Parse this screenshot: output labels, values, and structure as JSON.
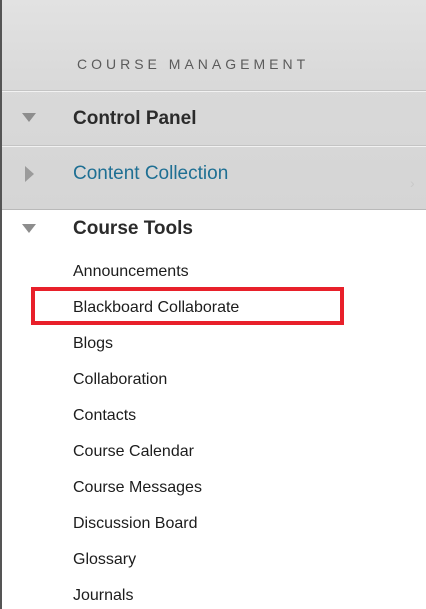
{
  "section_heading": "COURSE MANAGEMENT",
  "control_panel": {
    "label": "Control Panel",
    "expanded": true
  },
  "content_collection": {
    "label": "Content Collection",
    "expanded": false
  },
  "course_tools": {
    "label": "Course Tools",
    "expanded": true,
    "items": [
      "Announcements",
      "Blackboard Collaborate",
      "Blogs",
      "Collaboration",
      "Contacts",
      "Course Calendar",
      "Course Messages",
      "Discussion Board",
      "Glossary",
      "Journals"
    ]
  },
  "highlighted_item": "Blackboard Collaborate",
  "colors": {
    "link": "#1e6f93",
    "highlight_border": "#e8202a",
    "panel_background": "#d9d9d9"
  }
}
